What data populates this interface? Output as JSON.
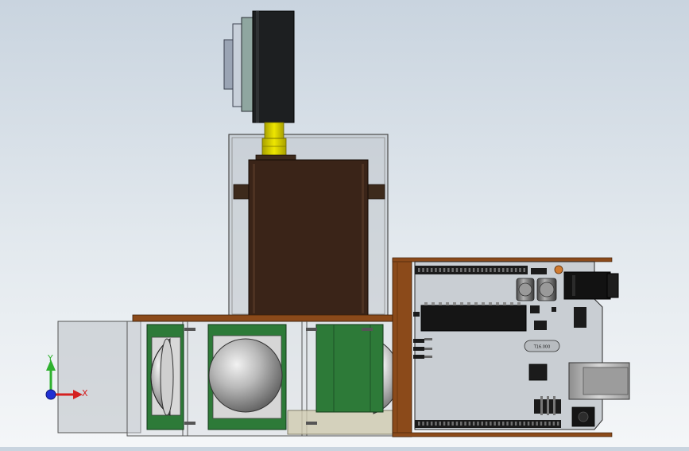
{
  "view": {
    "background_top": "#c9d4df",
    "background_bottom": "#f4f6f8"
  },
  "triad": {
    "y_label": "Y",
    "x_label": "X",
    "y_color": "#2fb12f",
    "x_color": "#d42020",
    "z_color": "#2030d4"
  },
  "board": {
    "crystal_label": "T16.000",
    "pcb_color": "#c9ced3",
    "header_color": "#1b1b1b"
  },
  "colors": {
    "wood": "#8b4a1a",
    "servo_body": "#3a2418",
    "shaft": "#d8d200",
    "pir_board": "#2d7a38",
    "acrylic": "#c0c4ca"
  }
}
